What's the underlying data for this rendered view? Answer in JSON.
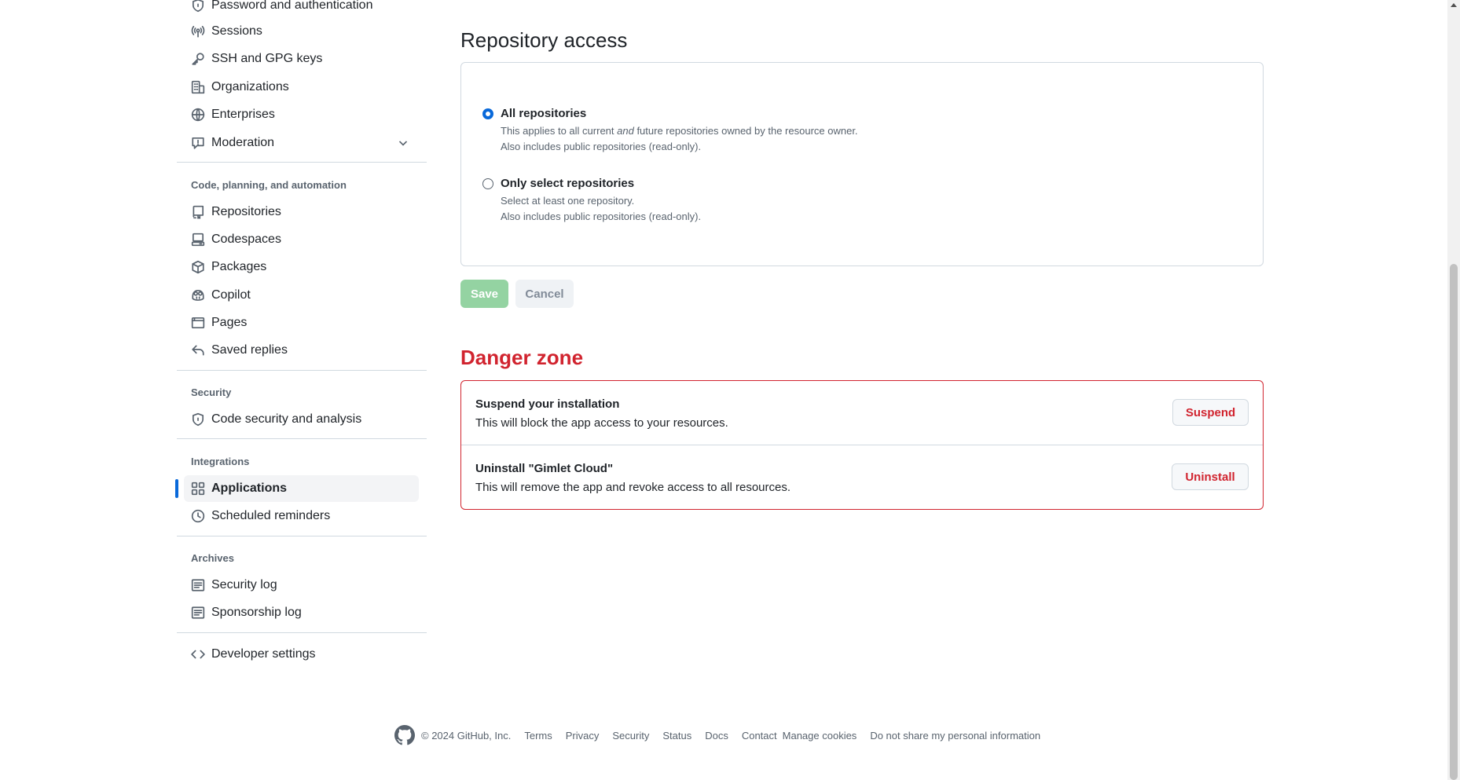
{
  "sidebar": {
    "items_top": [
      {
        "label": "Password and authentication",
        "icon": "shield-lock-icon"
      },
      {
        "label": "Sessions",
        "icon": "broadcast-icon"
      },
      {
        "label": "SSH and GPG keys",
        "icon": "key-icon"
      },
      {
        "label": "Organizations",
        "icon": "organization-icon"
      },
      {
        "label": "Enterprises",
        "icon": "globe-icon"
      },
      {
        "label": "Moderation",
        "icon": "report-icon"
      }
    ],
    "group_code": {
      "title": "Code, planning, and automation",
      "items": [
        {
          "label": "Repositories",
          "icon": "repo-icon"
        },
        {
          "label": "Codespaces",
          "icon": "codespaces-icon"
        },
        {
          "label": "Packages",
          "icon": "package-icon"
        },
        {
          "label": "Copilot",
          "icon": "copilot-icon"
        },
        {
          "label": "Pages",
          "icon": "browser-icon"
        },
        {
          "label": "Saved replies",
          "icon": "reply-icon"
        }
      ]
    },
    "group_security": {
      "title": "Security",
      "items": [
        {
          "label": "Code security and analysis",
          "icon": "shield-lock-icon"
        }
      ]
    },
    "group_integrations": {
      "title": "Integrations",
      "items": [
        {
          "label": "Applications",
          "icon": "apps-icon",
          "active": true
        },
        {
          "label": "Scheduled reminders",
          "icon": "clock-icon"
        }
      ]
    },
    "group_archives": {
      "title": "Archives",
      "items": [
        {
          "label": "Security log",
          "icon": "log-icon"
        },
        {
          "label": "Sponsorship log",
          "icon": "log-icon"
        }
      ]
    },
    "developer": {
      "label": "Developer settings",
      "icon": "code-icon"
    }
  },
  "repository_access": {
    "title": "Repository access",
    "options": [
      {
        "label": "All repositories",
        "desc_pre": "This applies to all current ",
        "desc_em": "and",
        "desc_post": " future repositories owned by the resource owner.",
        "desc2": "Also includes public repositories (read-only).",
        "checked": true
      },
      {
        "label": "Only select repositories",
        "desc1": "Select at least one repository.",
        "desc2": "Also includes public repositories (read-only).",
        "checked": false
      }
    ],
    "save_label": "Save",
    "cancel_label": "Cancel"
  },
  "danger_zone": {
    "title": "Danger zone",
    "rows": [
      {
        "title": "Suspend your installation",
        "desc": "This will block the app access to your resources.",
        "button": "Suspend"
      },
      {
        "title": "Uninstall \"Gimlet Cloud\"",
        "desc": "This will remove the app and revoke access to all resources.",
        "button": "Uninstall"
      }
    ]
  },
  "footer": {
    "copyright": "© 2024 GitHub, Inc.",
    "links": [
      "Terms",
      "Privacy",
      "Security",
      "Status",
      "Docs",
      "Contact",
      "Manage cookies",
      "Do not share my personal information"
    ]
  },
  "colors": {
    "accent": "#0969da",
    "danger": "#d1242f",
    "save_disabled": "#94d3a2",
    "muted": "#59636e",
    "border": "#d1d9e0"
  }
}
